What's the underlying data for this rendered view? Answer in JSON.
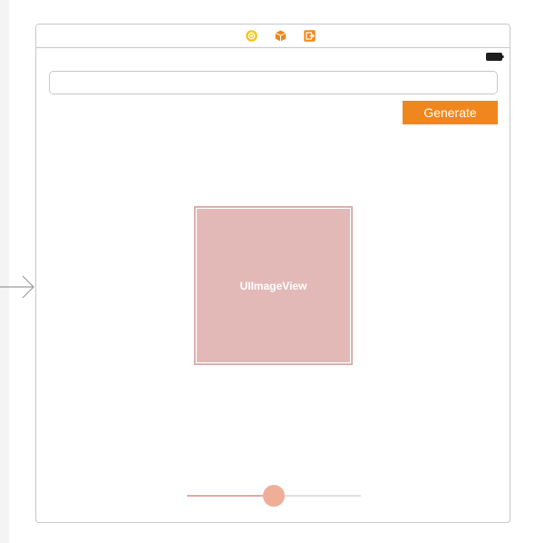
{
  "scene_dock": {
    "icons": [
      "view-controller-icon",
      "first-responder-icon",
      "exit-icon"
    ]
  },
  "status_bar": {
    "battery_icon": "battery-icon"
  },
  "text_field": {
    "value": "",
    "placeholder": ""
  },
  "generate_button": {
    "label": "Generate"
  },
  "image_view": {
    "label": "UIImageView"
  },
  "slider": {
    "value": 0.5,
    "min_track_color": "#e3a9a0",
    "max_track_color": "#e0e0e0",
    "thumb_color": "#eeae98"
  },
  "colors": {
    "accent": "#f0871e",
    "image_view_fill": "#e3b9b7"
  }
}
